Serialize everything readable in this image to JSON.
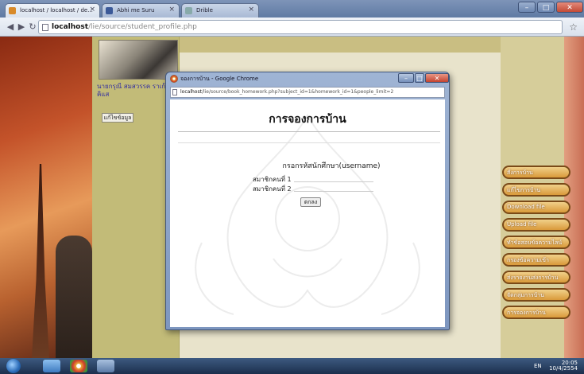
{
  "browser": {
    "tabs": [
      {
        "label": "localhost / localhost / de..."
      },
      {
        "label": "Abhi me Suru"
      },
      {
        "label": "Drible"
      }
    ],
    "address_host": "localhost",
    "address_path": "/lie/source/student_profile.php"
  },
  "sidebar_left": {
    "student_name": "นายกรุณี สมสวรรค ราเก้ต คิแส",
    "edit_button": "แก้ไขข้อมูล"
  },
  "right_menu": {
    "items": [
      {
        "label": "สั่งการบ้าน"
      },
      {
        "label": "แก้ไขการบ้าน"
      },
      {
        "label": "Download file"
      },
      {
        "label": "Upload file"
      },
      {
        "label": "ทำข้อสอบข้อความไลน์"
      },
      {
        "label": "กรองข้อความเข้า"
      },
      {
        "label": "ส่งรายงานส่งการบ้าน"
      },
      {
        "label": "จัดกลุ่มการบ้าน"
      },
      {
        "label": "การจองการบ้าน"
      }
    ]
  },
  "popup": {
    "title": "จองการบ้าน - Google Chrome",
    "address_host": "localhost",
    "address_path": "/lie/source/book_homework.php?subject_id=1&homework_id=1&people_limit=2",
    "heading": "การจองการบ้าน",
    "instruction": "กรอกรหัสนักศึกษา(username)",
    "member1_label": "สมาชิกคนที่ 1",
    "member2_label": "สมาชิกคนที่ 2",
    "submit_label": "ตกลง"
  },
  "taskbar": {
    "lang": "EN",
    "time": "20:05",
    "date": "10/4/2554"
  }
}
